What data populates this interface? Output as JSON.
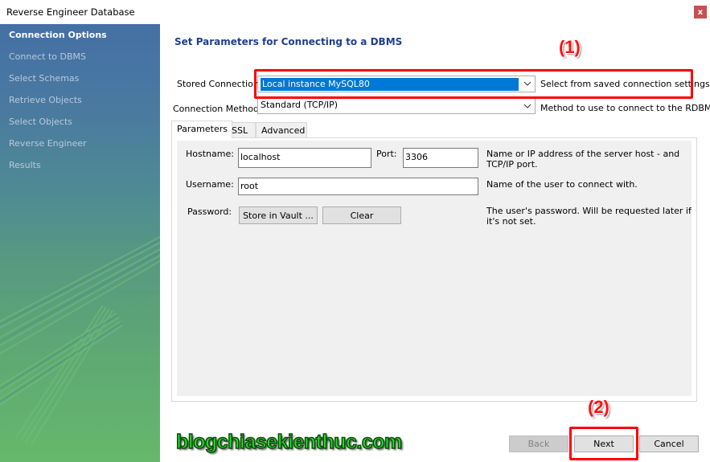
{
  "window": {
    "title": "Reverse Engineer Database",
    "close_icon": "close-icon",
    "close_label": "x"
  },
  "sidebar": {
    "items": [
      {
        "label": "Connection Options",
        "active": true
      },
      {
        "label": "Connect to DBMS",
        "active": false
      },
      {
        "label": "Select Schemas",
        "active": false
      },
      {
        "label": "Retrieve Objects",
        "active": false
      },
      {
        "label": "Select Objects",
        "active": false
      },
      {
        "label": "Reverse Engineer",
        "active": false
      },
      {
        "label": "Results",
        "active": false
      }
    ]
  },
  "main": {
    "title": "Set Parameters for Connecting to a DBMS",
    "stored_connection": {
      "label": "Stored Connection:",
      "value": "Local instance MySQL80",
      "description": "Select from saved connection settings"
    },
    "connection_method": {
      "label": "Connection Method:",
      "value": "Standard (TCP/IP)",
      "description": "Method to use to connect to the RDBMS"
    },
    "tabs": [
      {
        "label": "Parameters",
        "active": true
      },
      {
        "label": "SSL",
        "active": false
      },
      {
        "label": "Advanced",
        "active": false
      }
    ],
    "parameters": {
      "hostname_label": "Hostname:",
      "hostname_value": "localhost",
      "port_label": "Port:",
      "port_value": "3306",
      "host_description": "Name or IP address of the server host - and TCP/IP port.",
      "username_label": "Username:",
      "username_value": "root",
      "username_description": "Name of the user to connect with.",
      "password_label": "Password:",
      "store_in_vault_label": "Store in Vault ...",
      "clear_label": "Clear",
      "password_description": "The user's password. Will be requested later if it's not set."
    }
  },
  "footer": {
    "back_label": "Back",
    "next_label": "Next",
    "cancel_label": "Cancel"
  },
  "annotations": {
    "marker_1": "(1)",
    "marker_2": "(2)",
    "watermark": "blogchiasekienthuc.com",
    "highlight_color": "#ff0000"
  },
  "colors": {
    "selection": "#0078d7",
    "title_blue": "#1e3f8f",
    "close_red": "#c75050"
  }
}
